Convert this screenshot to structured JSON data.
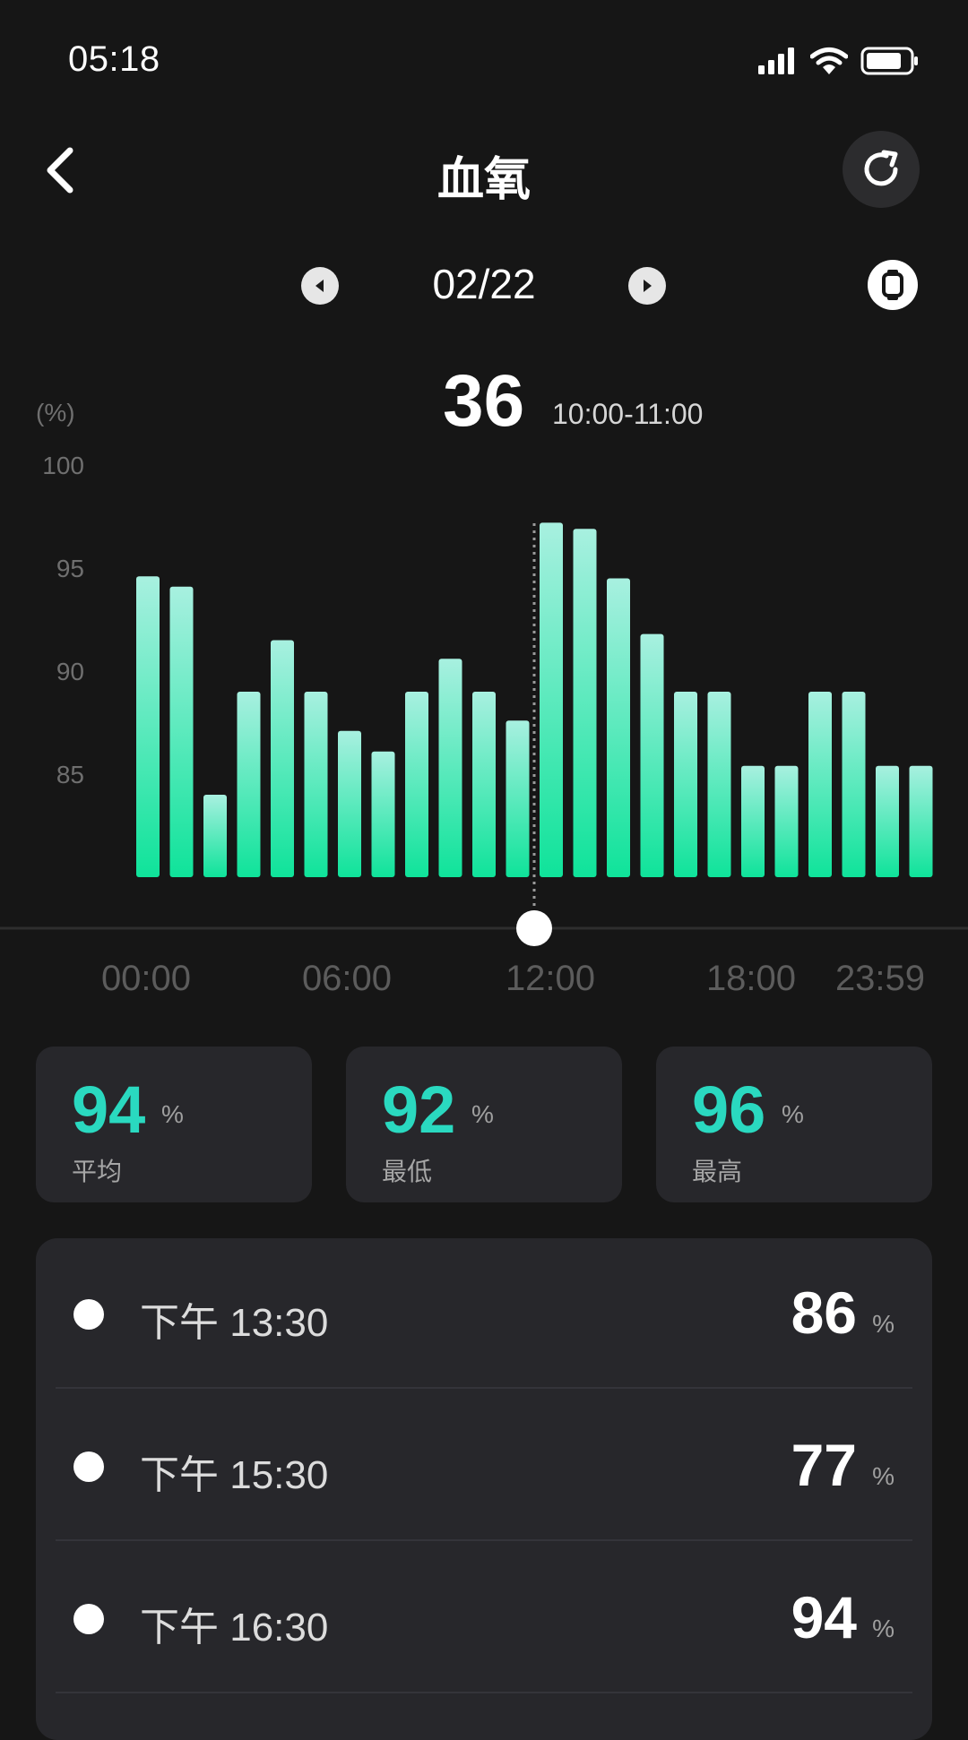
{
  "status_bar": {
    "time": "05:18"
  },
  "header": {
    "title": "血氧"
  },
  "date_nav": {
    "date": "02/22"
  },
  "selection": {
    "value": "36",
    "range": "10:00-11:00"
  },
  "chart_data": {
    "type": "bar",
    "y_unit_label": "(%)",
    "y_ticks": [
      "100",
      "95",
      "90",
      "85"
    ],
    "ylim": [
      80,
      100
    ],
    "x_ticks": [
      "00:00",
      "06:00",
      "12:00",
      "18:00",
      "23:59"
    ],
    "values": [
      94.6,
      94.1,
      84.0,
      89.0,
      91.5,
      89.0,
      87.1,
      86.1,
      89.0,
      90.6,
      89.0,
      87.6,
      97.2,
      96.9,
      94.5,
      91.8,
      89.0,
      89.0,
      85.4,
      85.4,
      89.0,
      89.0,
      85.4,
      85.4
    ],
    "selected_index": 12,
    "gradient": [
      "#a8f0e0",
      "#0fe39a"
    ]
  },
  "stats": [
    {
      "value": "94",
      "unit": "%",
      "label": "平均"
    },
    {
      "value": "92",
      "unit": "%",
      "label": "最低"
    },
    {
      "value": "96",
      "unit": "%",
      "label": "最高"
    }
  ],
  "records": [
    {
      "time": "下午 13:30",
      "value": "86",
      "unit": "%"
    },
    {
      "time": "下午 15:30",
      "value": "77",
      "unit": "%"
    },
    {
      "time": "下午 16:30",
      "value": "94",
      "unit": "%"
    }
  ],
  "colors": {
    "accent": "#2ad9c0",
    "background": "#161616",
    "card": "#27272b"
  },
  "icons": [
    "signal-icon",
    "wifi-icon",
    "battery-icon",
    "back-icon",
    "refresh-icon",
    "prev-icon",
    "next-icon",
    "watch-icon"
  ]
}
